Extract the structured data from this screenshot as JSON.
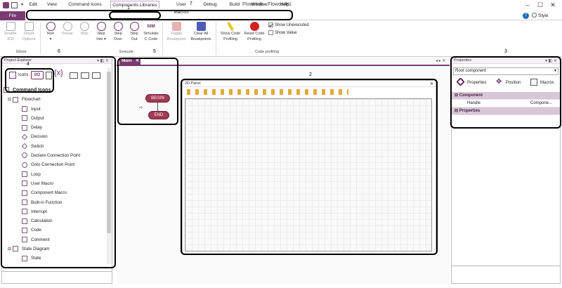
{
  "window": {
    "title": "Flowcode - Flowcode1",
    "style_label": "Style",
    "help_icon": "help-icon"
  },
  "menu": {
    "file": "File",
    "tabs": [
      "Edit",
      "View",
      "Command Icons",
      "Components Libraries",
      "User Macros",
      "Debug",
      "Build",
      "Window",
      "Help"
    ],
    "active": "Components Libraries"
  },
  "ribbon": {
    "ghost": {
      "buttons": [
        {
          "label": "Enable",
          "label2": "ICD"
        },
        {
          "label": "Ghost",
          "label2": "Options"
        }
      ],
      "group": "Ghost"
    },
    "execute": {
      "buttons": [
        {
          "label": "Run",
          "label2": "▾"
        },
        {
          "label": "Pause",
          "label2": ""
        },
        {
          "label": "Stop",
          "label2": ""
        },
        {
          "label": "Step",
          "label2": "Into ▾"
        },
        {
          "label": "Step",
          "label2": "Over"
        },
        {
          "label": "Step",
          "label2": "Out"
        },
        {
          "label": "Simulate",
          "label2": "C Code"
        }
      ],
      "group": "Execute"
    },
    "breakpoints": {
      "buttons": [
        {
          "label": "Toggle",
          "label2": "Breakpoint"
        },
        {
          "label": "Clear All",
          "label2": "Breakpoints"
        }
      ]
    },
    "profiling": {
      "buttons": [
        {
          "label": "Show Code",
          "label2": "Profiling"
        },
        {
          "label": "Reset Code",
          "label2": "Profiling"
        }
      ],
      "group": "Code profiling"
    },
    "checks": [
      {
        "label": "Show Unexecuted",
        "checked": true
      },
      {
        "label": "Show Value",
        "checked": false
      }
    ],
    "sim_text": "SIM"
  },
  "project_explorer": {
    "title": "Project Explorer",
    "tabs": {
      "icons": "Icons",
      "io": "I/O",
      "vars": "{x}"
    },
    "root": "Command Icons",
    "flowchart": "Flowchart",
    "items": [
      "Input",
      "Output",
      "Delay",
      "Decision",
      "Switch",
      "Declare Connection Point",
      "Goto Connection Point",
      "Loop",
      "User Macro",
      "Component Macro",
      "Built-in Function",
      "Interrupt",
      "Calculation",
      "Code",
      "Comment"
    ],
    "state_diagram": "State Diagram",
    "state_items": [
      "State"
    ]
  },
  "canvas": {
    "tab": "Main",
    "begin": "BEGIN",
    "end": "END",
    "panel_title": "2D Panel"
  },
  "properties": {
    "title": "Properties",
    "dropdown": "Root component",
    "toolbar": [
      "Properties",
      "Position",
      "Macros"
    ],
    "component_cat": "Component",
    "handle_label": "Handle",
    "handle_value": "Compone...",
    "properties_cat": "Properties"
  },
  "annotations": [
    "1",
    "2",
    "3",
    "4",
    "5",
    "6",
    "7"
  ],
  "colors": {
    "accent": "#7a3b72",
    "begin_end": "#a33a55"
  }
}
